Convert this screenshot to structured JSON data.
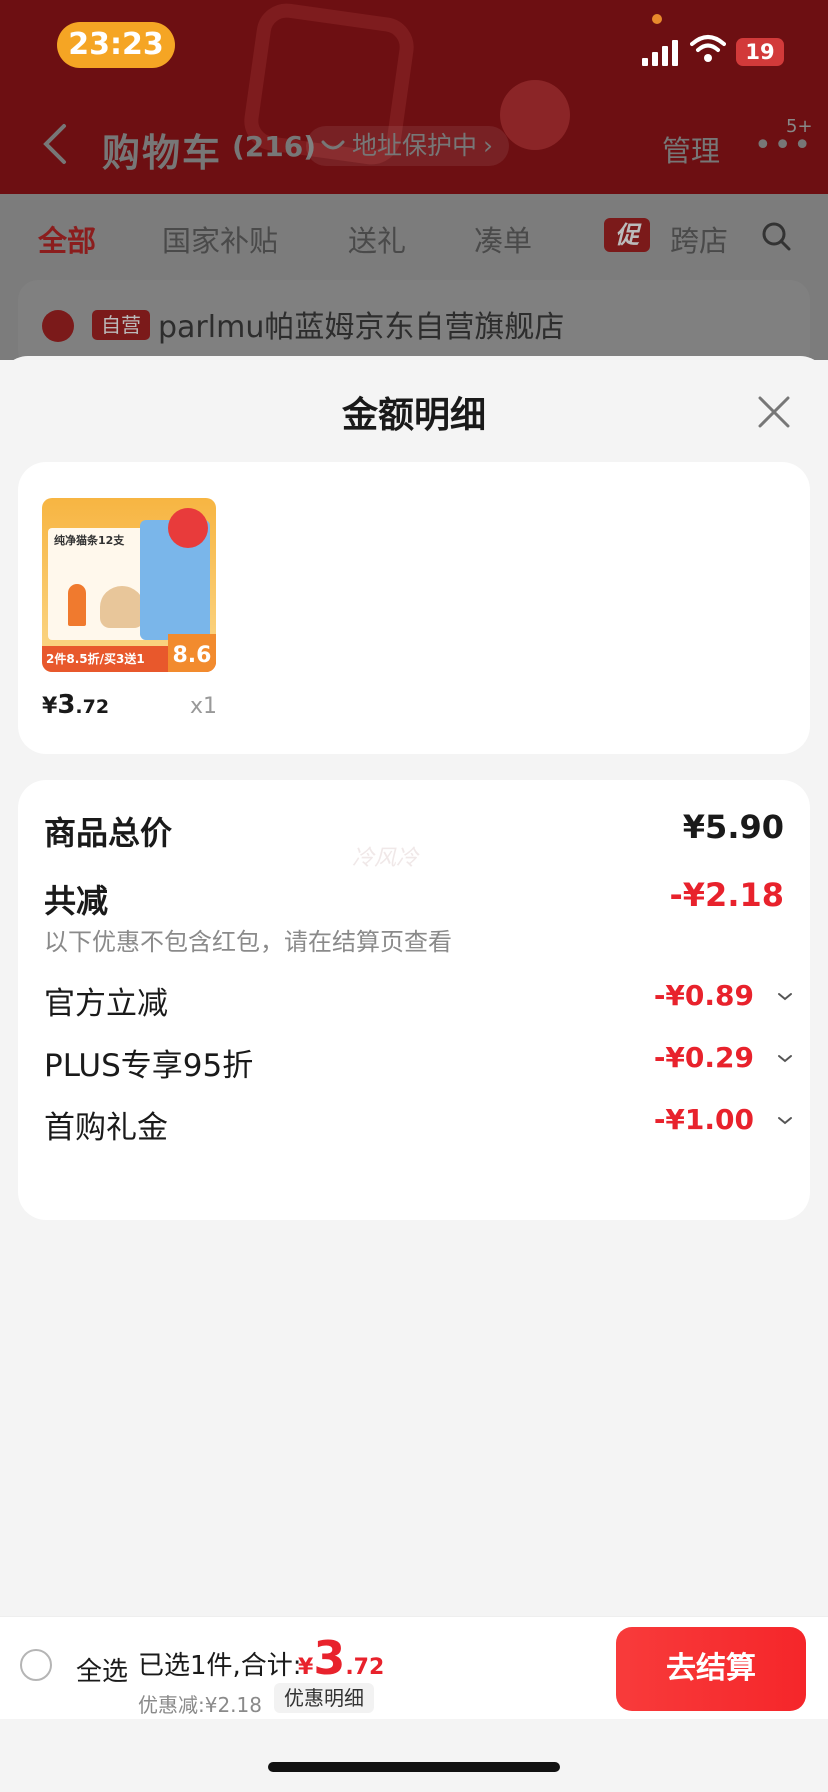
{
  "status_bar": {
    "time": "23:23",
    "battery": "19"
  },
  "nav": {
    "title": "购物车",
    "count": "(216)",
    "address_protect": "地址保护中",
    "manage": "管理",
    "more_badge": "5+"
  },
  "tabs": [
    "全部",
    "国家补贴",
    "送礼",
    "凑单",
    "跨店"
  ],
  "promo_badge": "促",
  "store": {
    "tag": "自营",
    "name": "parlmu帕蓝姆京东自营旗舰店"
  },
  "sheet": {
    "title": "金额明细",
    "product": {
      "image_label": "纯净猫条12支",
      "image_bar_text": "2件8.5折/买3送1",
      "image_price_tag": "8.6",
      "price_currency": "¥",
      "price_int": "3",
      "price_dec": ".72",
      "quantity": "x1"
    },
    "summary": {
      "total_label": "商品总价",
      "total_value": "¥5.90",
      "watermark": "冷风冷",
      "reduce_label": "共减",
      "reduce_value": "-¥2.18",
      "note": "以下优惠不包含红包，请在结算页查看",
      "discounts": [
        {
          "label": "官方立减",
          "amount": "-¥0.89"
        },
        {
          "label": "PLUS专享95折",
          "amount": "-¥0.29"
        },
        {
          "label": "首购礼金",
          "amount": "-¥1.00"
        }
      ]
    }
  },
  "bottom_bar": {
    "select_all": "全选",
    "selected_text": "已选1件,合计:",
    "total_currency": "¥",
    "total_int": "3",
    "total_dec": ".72",
    "discount_text": "优惠减:¥2.18",
    "discount_detail": "优惠明细",
    "checkout": "去结算"
  },
  "colors": {
    "accent_red": "#e8222c",
    "header_bg": "#6d0f12",
    "time_pill": "#f5a524"
  }
}
